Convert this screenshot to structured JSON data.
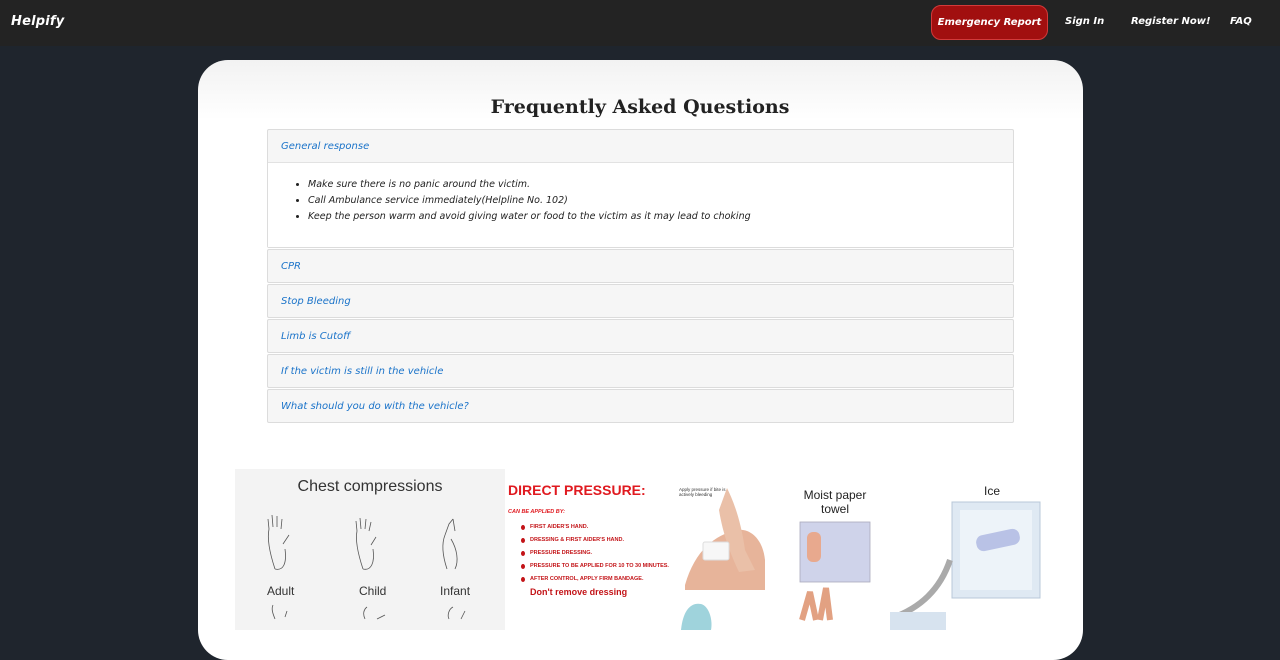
{
  "navbar": {
    "brand": "Helpify",
    "emergency_label": "Emergency Report",
    "signin_label": "Sign In",
    "register_label": "Register Now!",
    "faq_label": "FAQ"
  },
  "faq": {
    "title": "Frequently Asked Questions",
    "items": [
      {
        "title": "General response",
        "expanded": true,
        "body": [
          "Make sure there is no panic around the victim.",
          "Call Ambulance service immediately(Helpline No. 102)",
          "Keep the person warm and avoid giving water or food to the victim as it may lead to choking"
        ]
      },
      {
        "title": "CPR",
        "expanded": false
      },
      {
        "title": "Stop Bleeding",
        "expanded": false
      },
      {
        "title": "Limb is Cutoff",
        "expanded": false
      },
      {
        "title": "If the victim is still in the vehicle",
        "expanded": false
      },
      {
        "title": "What should you do with the vehicle?",
        "expanded": false
      }
    ]
  },
  "images": {
    "chest": {
      "title": "Chest compressions",
      "labels": [
        "Adult",
        "Child",
        "Infant"
      ]
    },
    "pressure": {
      "title": "DIRECT PRESSURE:",
      "subtitle": "CAN BE APPLIED BY:",
      "items": [
        "FIRST AIDER'S HAND.",
        "DRESSING & FIRST AIDER'S HAND.",
        "PRESSURE DRESSING.",
        "PRESSURE TO BE APPLIED FOR 10 TO 30 MINUTES.",
        "AFTER CONTROL, APPLY FIRM BANDAGE."
      ],
      "last": "Don't remove dressing",
      "note": "Apply pressure if bite is actively bleeding"
    },
    "towel": {
      "towel_label": "Moist paper towel",
      "ice_label": "Ice"
    }
  },
  "colors": {
    "navbar_bg": "#232323",
    "page_bg": "#1f252d",
    "emergency_bg": "#a10f0f",
    "link_blue": "#1a73c9",
    "pressure_red": "#e0191f"
  }
}
